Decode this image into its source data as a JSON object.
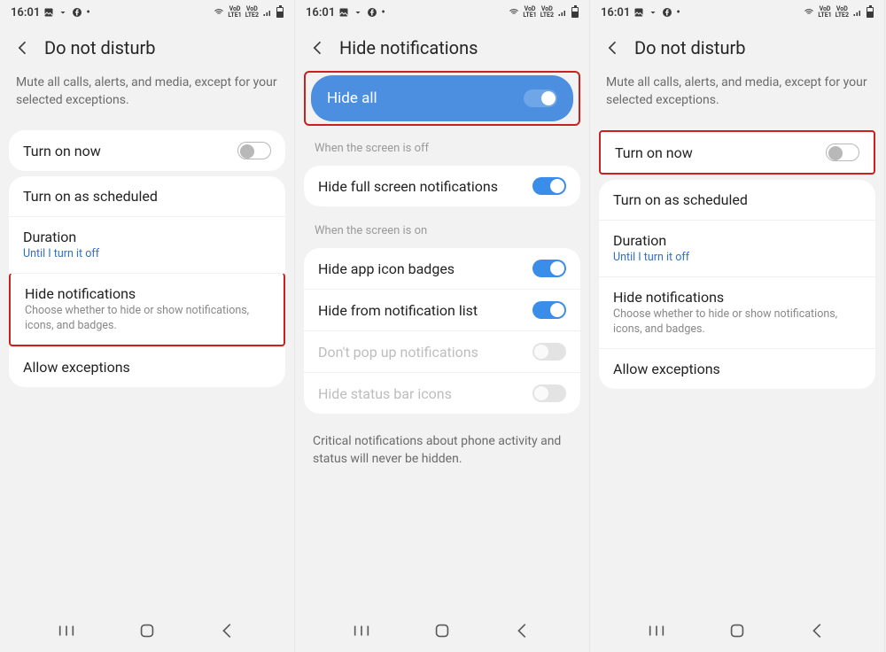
{
  "status": {
    "time": "16:01",
    "lte1": "VoD LTE1",
    "lte2": "VoD LTE2"
  },
  "screen1": {
    "title": "Do not disturb",
    "intro": "Mute all calls, alerts, and media, except for your selected exceptions.",
    "turn_on": "Turn on now",
    "scheduled": "Turn on as scheduled",
    "duration": "Duration",
    "duration_sub": "Until I turn it off",
    "hide_notifs": "Hide notifications",
    "hide_notifs_sub": "Choose whether to hide or show notifications, icons, and badges.",
    "allow": "Allow exceptions"
  },
  "screen2": {
    "title": "Hide notifications",
    "hide_all": "Hide all",
    "section_off": "When the screen is off",
    "full_screen": "Hide full screen notifications",
    "section_on": "When the screen is on",
    "badges": "Hide app icon badges",
    "list": "Hide from notification list",
    "popup": "Don't pop up notifications",
    "statusbar_icons": "Hide status bar icons",
    "footnote": "Critical notifications about phone activity and status will never be hidden."
  },
  "screen3": {
    "title": "Do not disturb",
    "intro": "Mute all calls, alerts, and media, except for your selected exceptions.",
    "turn_on": "Turn on now",
    "scheduled": "Turn on as scheduled",
    "duration": "Duration",
    "duration_sub": "Until I turn it off",
    "hide_notifs": "Hide notifications",
    "hide_notifs_sub": "Choose whether to hide or show notifications, icons, and badges.",
    "allow": "Allow exceptions"
  }
}
